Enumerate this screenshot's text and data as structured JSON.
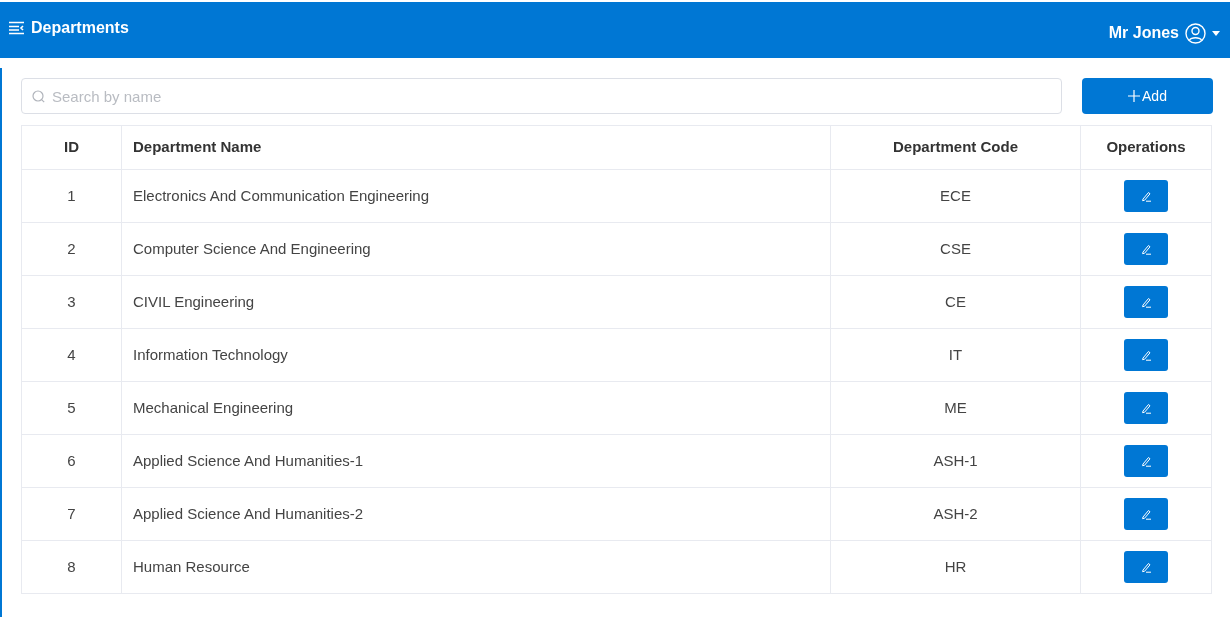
{
  "header": {
    "title": "Departments",
    "user": "Mr Jones"
  },
  "search": {
    "placeholder": "Search by name"
  },
  "add_button": {
    "label": "Add"
  },
  "table": {
    "columns": [
      "ID",
      "Department Name",
      "Department Code",
      "Operations"
    ],
    "rows": [
      {
        "id": "1",
        "name": "Electronics And Communication Engineering",
        "code": "ECE"
      },
      {
        "id": "2",
        "name": "Computer Science And Engineering",
        "code": "CSE"
      },
      {
        "id": "3",
        "name": "CIVIL Engineering",
        "code": "CE"
      },
      {
        "id": "4",
        "name": "Information Technology",
        "code": "IT"
      },
      {
        "id": "5",
        "name": "Mechanical Engineering",
        "code": "ME"
      },
      {
        "id": "6",
        "name": "Applied Science And Humanities-1",
        "code": "ASH-1"
      },
      {
        "id": "7",
        "name": "Applied Science And Humanities-2",
        "code": "ASH-2"
      },
      {
        "id": "8",
        "name": "Human Resource",
        "code": "HR"
      }
    ]
  }
}
